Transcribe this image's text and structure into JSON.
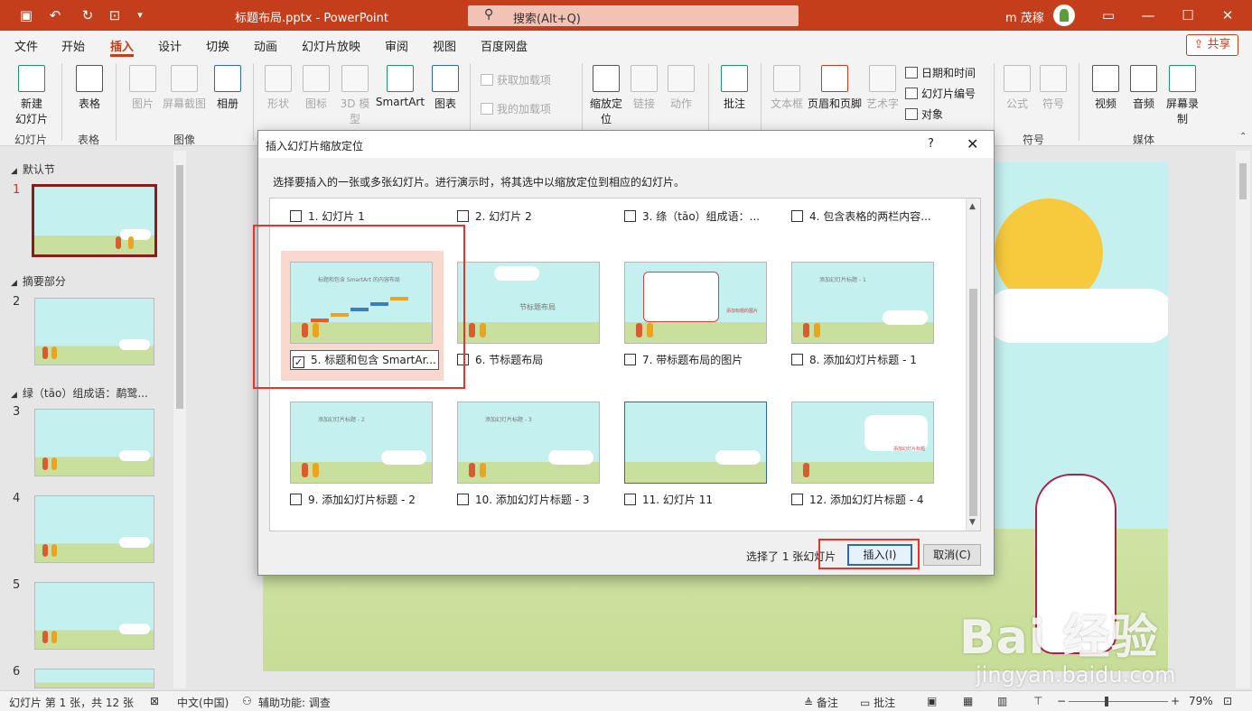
{
  "titlebar": {
    "filename": "标题布局.pptx",
    "app": "PowerPoint",
    "search_placeholder": "搜索(Alt+Q)",
    "user": "m 茂稼",
    "icons": [
      "save-icon",
      "undo-icon",
      "redo-icon",
      "presenter-icon",
      "customize-icon"
    ]
  },
  "menu": {
    "tabs": [
      "文件",
      "开始",
      "插入",
      "设计",
      "切换",
      "动画",
      "幻灯片放映",
      "审阅",
      "视图",
      "百度网盘"
    ],
    "active": "插入",
    "share": "共享"
  },
  "ribbon": {
    "new_slide": "新建",
    "new_slide2": "幻灯片",
    "table": "表格",
    "picture": "图片",
    "screenshot": "屏幕截图",
    "album": "相册",
    "shapes": "形状",
    "icons": "图标",
    "model3d": "3D 模型",
    "smartart": "SmartArt",
    "chart": "图表",
    "get_addins": "获取加载项",
    "my_addins": "我的加载项",
    "zoom": "缩放定位",
    "link": "链接",
    "action": "动作",
    "comment": "批注",
    "textbox": "文本框",
    "header_footer": "页眉和页脚",
    "wordart": "艺术字",
    "date_time": "日期和时间",
    "slide_number": "幻灯片编号",
    "object": "对象",
    "equation": "公式",
    "symbol": "符号",
    "video": "视频",
    "audio": "音频",
    "screen_record": "屏幕录制",
    "groups": {
      "slides": "幻灯片",
      "tables": "表格",
      "images": "图像",
      "symbols": "符号",
      "media": "媒体"
    }
  },
  "leftpane": {
    "sections": [
      "默认节",
      "摘要部分",
      "绿（tāo）组成语：鹬鹭..."
    ],
    "slide_numbers": [
      "1",
      "2",
      "3",
      "4",
      "5",
      "6"
    ]
  },
  "dialog": {
    "title": "插入幻灯片缩放定位",
    "help": "?",
    "instruction": "选择要插入的一张或多张幻灯片。进行演示时，将其选中以缩放定位到相应的幻灯片。",
    "slides": [
      {
        "label": "1. 幻灯片 1",
        "checked": false
      },
      {
        "label": "2. 幻灯片 2",
        "checked": false
      },
      {
        "label": "3. 绦（tāo）组成语：...",
        "checked": false
      },
      {
        "label": "4. 包含表格的两栏内容...",
        "checked": false
      },
      {
        "label": "5. 标题和包含 SmartAr...",
        "checked": true
      },
      {
        "label": "6. 节标题布局",
        "checked": false
      },
      {
        "label": "7. 带标题布局的图片",
        "checked": false
      },
      {
        "label": "8. 添加幻灯片标题 - 1",
        "checked": false
      },
      {
        "label": "9. 添加幻灯片标题 - 2",
        "checked": false
      },
      {
        "label": "10. 添加幻灯片标题 - 3",
        "checked": false
      },
      {
        "label": "11. 幻灯片 11",
        "checked": false
      },
      {
        "label": "12. 添加幻灯片标题 - 4",
        "checked": false
      }
    ],
    "thumb_texts": {
      "s5": "标题和包含 SmartArt 的内容布局",
      "s6": "节标题布局",
      "s7": "添加标题的图片",
      "s8": "添加幻灯片标题 - 1",
      "s9": "添加幻灯片标题 - 2",
      "s10": "添加幻灯片标题 - 3",
      "s12": "添加幻灯片标题"
    },
    "selected_count": "选择了 1 张幻灯片",
    "insert": "插入(I)",
    "cancel": "取消(C)"
  },
  "statusbar": {
    "slide_info": "幻灯片 第 1 张，共 12 张",
    "language": "中文(中国)",
    "accessibility": "辅助功能: 调查",
    "notes": "备注",
    "comments": "批注",
    "zoom": "79%"
  },
  "watermark": {
    "brand": "Bai 经验",
    "url": "jingyan.baidu.com"
  },
  "colors": {
    "accent": "#c43e1c",
    "annotation": "#e8332a",
    "selection_bg": "#f9d9cf"
  }
}
